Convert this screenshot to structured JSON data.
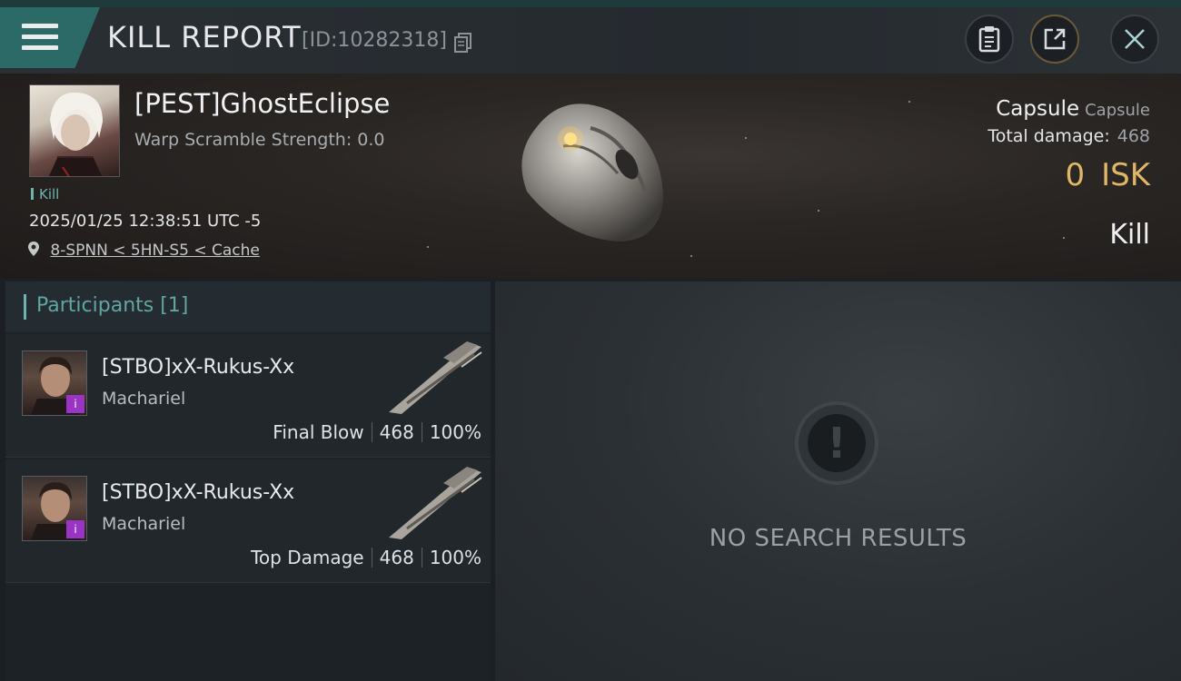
{
  "header": {
    "title": "KILL REPORT",
    "report_id": "[ID:10282318]"
  },
  "victim": {
    "name": "[PEST]GhostEclipse",
    "warp_scramble": "Warp Scramble Strength: 0.0",
    "tag": "Kill",
    "datetime": "2025/01/25 12:38:51 UTC -5",
    "location": "8-SPNN < 5HN-S5 < Cache",
    "ship_name": "Capsule",
    "ship_type": "Capsule",
    "total_damage_label": "Total damage:",
    "total_damage": "468",
    "isk_value": "0",
    "isk_label": "ISK",
    "result": "Kill"
  },
  "participants": {
    "title": "Participants [1]",
    "rows": [
      {
        "name": "[STBO]xX-Rukus-Xx",
        "ship": "Machariel",
        "role": "Final Blow",
        "damage": "468",
        "percent": "100%",
        "badge": "i"
      },
      {
        "name": "[STBO]xX-Rukus-Xx",
        "ship": "Machariel",
        "role": "Top Damage",
        "damage": "468",
        "percent": "100%",
        "badge": "i"
      }
    ]
  },
  "empty_state": {
    "icon": "exclamation-icon",
    "text": "NO SEARCH RESULTS"
  },
  "colors": {
    "accent": "#6fb3ad",
    "isk": "#e0b766",
    "badge": "#9a34c4"
  }
}
